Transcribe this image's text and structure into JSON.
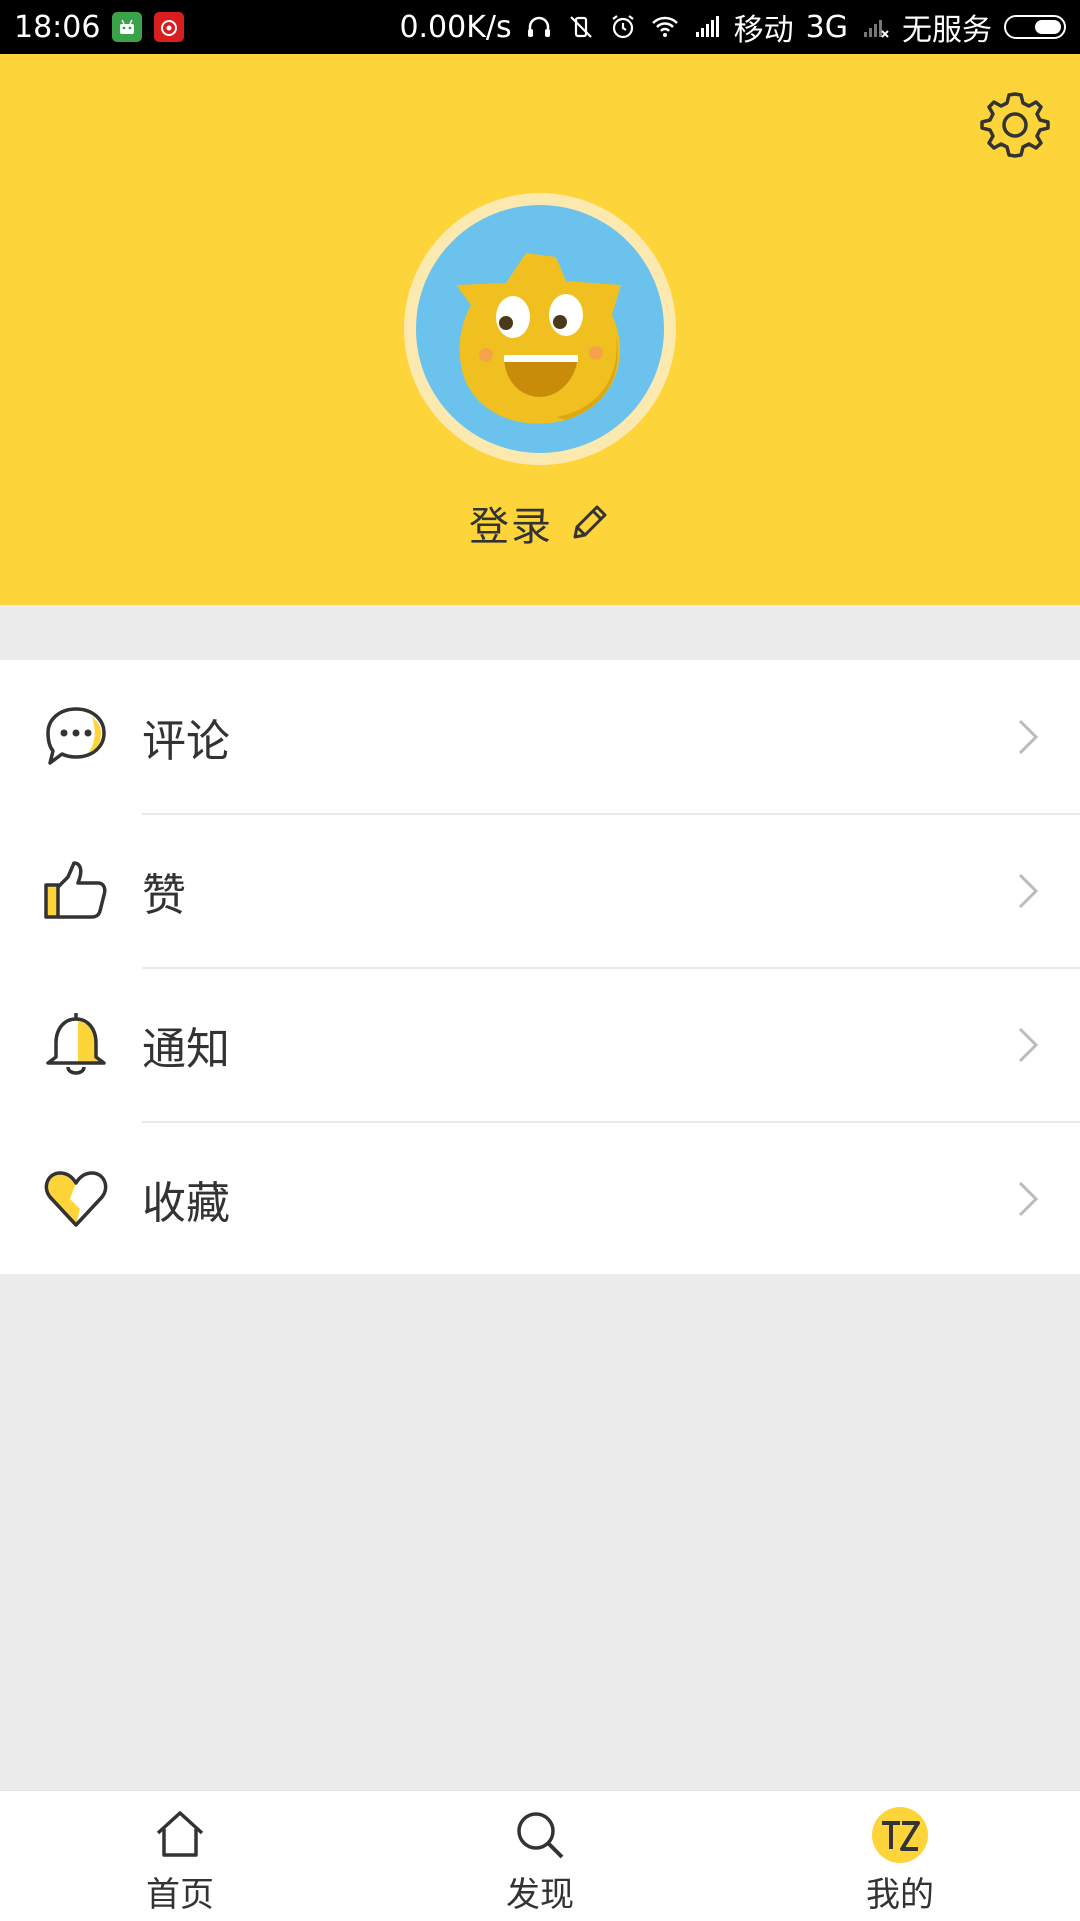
{
  "status_bar": {
    "time": "18:06",
    "net_speed": "0.00K/s",
    "carrier1": "移动",
    "network": "3G",
    "carrier2": "无服务",
    "app_badges": [
      "android-app-icon",
      "netease-music-icon"
    ]
  },
  "header": {
    "login_label": "登录",
    "bg_color": "#fdd53a"
  },
  "menu": {
    "items": [
      {
        "label": "评论",
        "icon": "comment-icon"
      },
      {
        "label": "赞",
        "icon": "thumbs-up-icon"
      },
      {
        "label": "通知",
        "icon": "bell-icon"
      },
      {
        "label": "收藏",
        "icon": "heart-icon"
      }
    ]
  },
  "bottom_nav": {
    "tabs": [
      {
        "label": "首页",
        "icon": "home-icon"
      },
      {
        "label": "发现",
        "icon": "search-icon"
      },
      {
        "label": "我的",
        "icon": "profile-logo-icon",
        "active": true
      }
    ]
  },
  "colors": {
    "accent": "#fdd53a",
    "avatar_bg": "#6bc2ec",
    "page_bg": "#ececec"
  }
}
